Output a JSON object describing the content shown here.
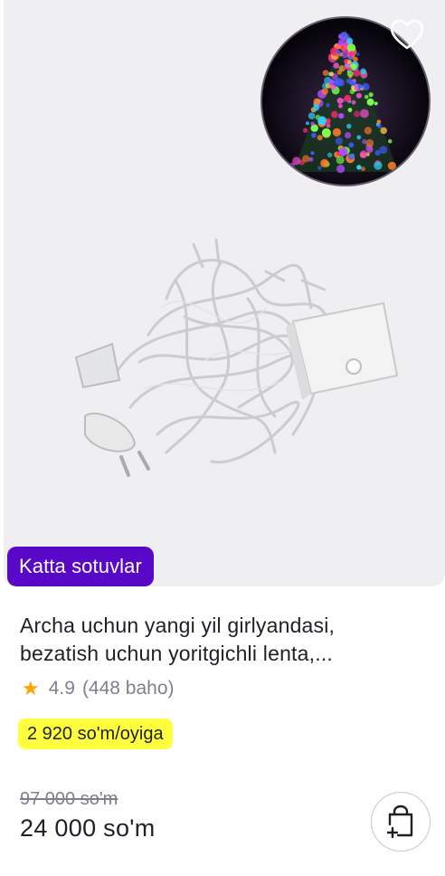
{
  "product": {
    "badge": "Katta sotuvlar",
    "title_line1": "Archa uchun yangi yil girlyandasi,",
    "title_line2": "bezatish uchun yoritgichli lenta,...",
    "rating": "4.9",
    "reviews": "(448 baho)",
    "installment": "2 920 so'm/oyiga",
    "old_price": "97 000 so'm",
    "price": "24 000 so'm"
  },
  "icons": {
    "favorite": "heart-outline-icon",
    "rating": "star-icon",
    "cart": "shopping-bag-plus-icon"
  },
  "colors": {
    "badge_bg": "#5a08c7",
    "installment_bg": "#ffff3d",
    "star": "#ffa500",
    "image_bg": "#efeff1"
  }
}
